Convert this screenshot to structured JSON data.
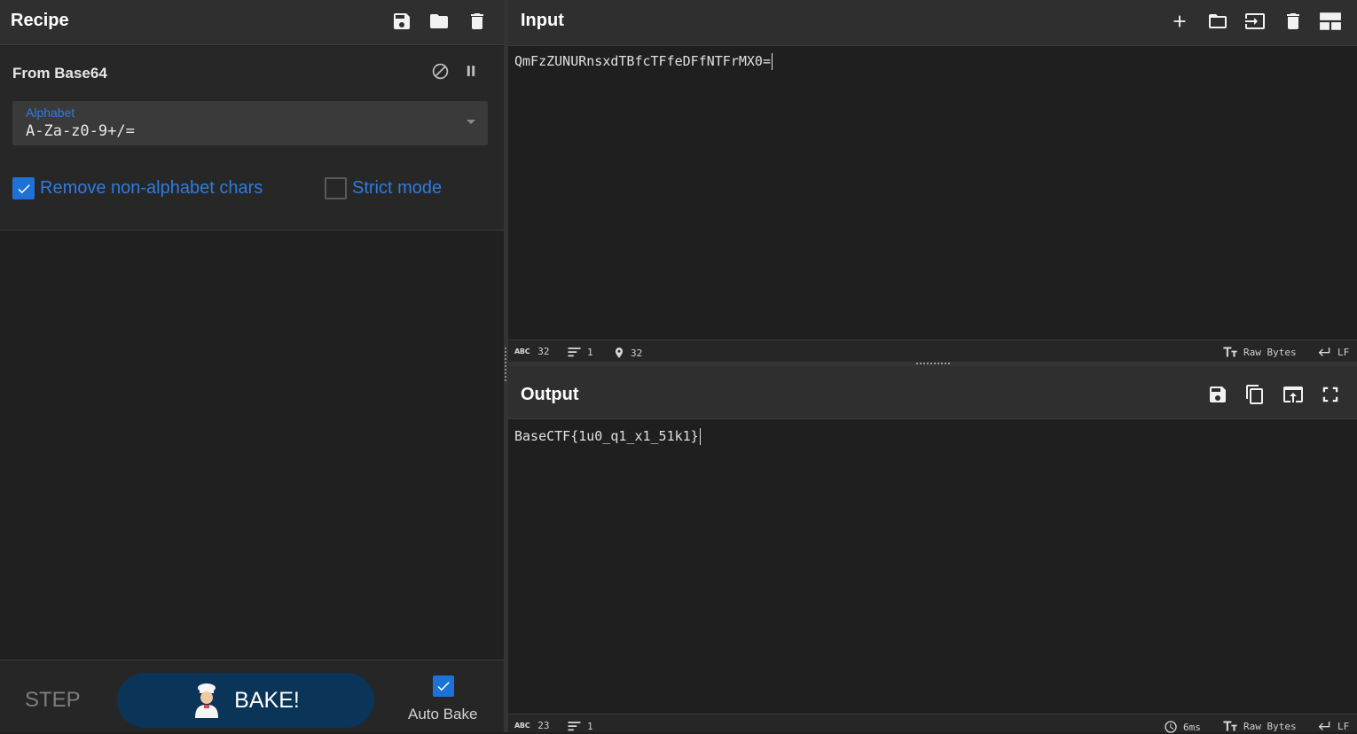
{
  "recipe": {
    "title": "Recipe",
    "operation": {
      "name": "From Base64",
      "alphabet_label": "Alphabet",
      "alphabet_value": "A-Za-z0-9+/=",
      "remove_non_alphabet_label": "Remove non-alphabet chars",
      "remove_non_alphabet_checked": true,
      "strict_mode_label": "Strict mode",
      "strict_mode_checked": false
    },
    "step_label": "STEP",
    "bake_label": "BAKE!",
    "auto_bake_label": "Auto Bake",
    "auto_bake_checked": true
  },
  "input": {
    "title": "Input",
    "text": "QmFzZUNURnsxdTBfcTFfeDFfNTFrMX0=",
    "status": {
      "length": "32",
      "lines": "1",
      "position": "32",
      "encoding": "Raw Bytes",
      "eol": "LF"
    }
  },
  "output": {
    "title": "Output",
    "text": "BaseCTF{1u0_q1_x1_51k1}",
    "status": {
      "length": "23",
      "lines": "1",
      "time": "6ms",
      "encoding": "Raw Bytes",
      "eol": "LF"
    }
  },
  "colors": {
    "accent": "#2f7be0",
    "checkbox": "#1d72d8",
    "bake_button": "#0b3459",
    "panel_bg": "#202020",
    "header_bg": "#2f2f2f"
  },
  "icons": {
    "recipe_header": [
      "save-icon",
      "folder-icon",
      "trash-icon"
    ],
    "operation": [
      "disable-icon",
      "pause-icon"
    ],
    "input_header": [
      "plus-icon",
      "folder-icon",
      "input-file-icon",
      "trash-icon",
      "layout-icon"
    ],
    "output_header": [
      "save-icon",
      "copy-icon",
      "replace-input-icon",
      "fullscreen-icon"
    ]
  }
}
